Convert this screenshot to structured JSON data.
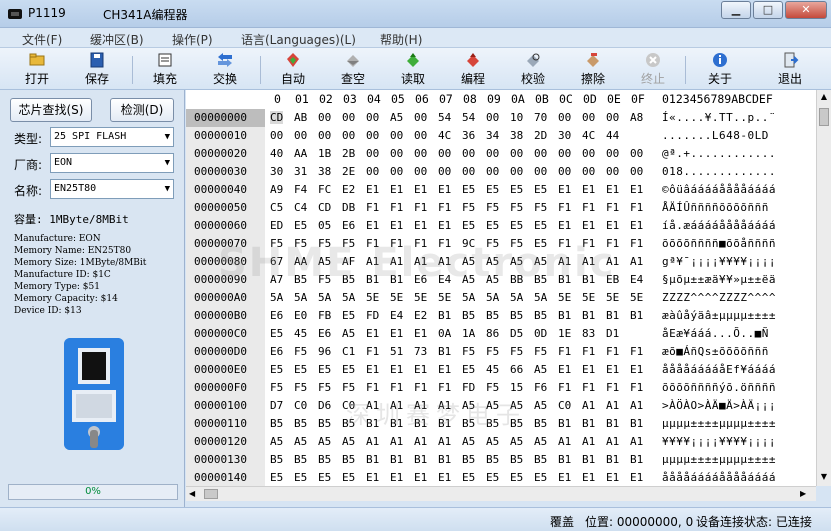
{
  "window": {
    "code": "P1119",
    "title": "CH341A编程器"
  },
  "menu": [
    {
      "label": "文件(F)"
    },
    {
      "label": "缓冲区(B)"
    },
    {
      "label": "操作(P)"
    },
    {
      "label": "语言(Languages)(L)"
    },
    {
      "label": "帮助(H)"
    }
  ],
  "toolbar": [
    {
      "label": "打开",
      "icon": "open-folder-icon",
      "enabled": true
    },
    {
      "label": "保存",
      "icon": "save-disk-icon",
      "enabled": true
    },
    {
      "label": "填充",
      "icon": "fill-icon",
      "enabled": true
    },
    {
      "label": "交换",
      "icon": "swap-icon",
      "enabled": true
    },
    {
      "label": "自动",
      "icon": "auto-icon",
      "enabled": true
    },
    {
      "label": "查空",
      "icon": "blank-check-icon",
      "enabled": true
    },
    {
      "label": "读取",
      "icon": "read-icon",
      "enabled": true
    },
    {
      "label": "编程",
      "icon": "program-icon",
      "enabled": true
    },
    {
      "label": "校验",
      "icon": "verify-icon",
      "enabled": true
    },
    {
      "label": "擦除",
      "icon": "erase-icon",
      "enabled": true
    },
    {
      "label": "终止",
      "icon": "stop-icon",
      "enabled": false
    },
    {
      "label": "关于",
      "icon": "info-icon",
      "enabled": true
    },
    {
      "label": "退出",
      "icon": "exit-icon",
      "enabled": true
    }
  ],
  "left": {
    "find_chip": "芯片查找(S)",
    "detect": "检测(D)",
    "type_label": "类型:",
    "type_value": "25 SPI FLASH",
    "vendor_label": "厂商:",
    "vendor_value": "EON",
    "name_label": "名称:",
    "name_value": "EN25T80",
    "capacity": "容量: 1MByte/8MBit",
    "info": [
      "Manufacture: EON",
      "Memory Name: EN25T80",
      "Memory Size: 1MByte/8MBit",
      "Manufacture ID: $1C",
      "Memory Type: $51",
      "Memory Capacity: $14",
      "Device ID: $13"
    ],
    "progress_value": 0,
    "progress_text": "0%"
  },
  "hex": {
    "columns": [
      "0",
      "01",
      "02",
      "03",
      "04",
      "05",
      "06",
      "07",
      "08",
      "09",
      "0A",
      "0B",
      "0C",
      "0D",
      "0E",
      "0F"
    ],
    "ascii_header": "0123456789ABCDEF",
    "watermark": "SHME Electronic",
    "watermark2": "深圳赛梦电子",
    "rows": [
      {
        "addr": "00000000",
        "bytes": [
          "CD",
          "AB",
          "00",
          "00",
          "00",
          "A5",
          "00",
          "54",
          "54",
          "00",
          "10",
          "70",
          "00",
          "00",
          "00",
          "A8"
        ],
        "ascii": "Í«....¥.TT..p..¨"
      },
      {
        "addr": "00000010",
        "bytes": [
          "00",
          "00",
          "00",
          "00",
          "00",
          "00",
          "00",
          "4C",
          "36",
          "34",
          "38",
          "2D",
          "30",
          "4C",
          "44"
        ],
        "ascii": ".......L648-0LD"
      },
      {
        "addr": "00000020",
        "bytes": [
          "40",
          "AA",
          "1B",
          "2B",
          "00",
          "00",
          "00",
          "00",
          "00",
          "00",
          "00",
          "00",
          "00",
          "00",
          "00",
          "00"
        ],
        "ascii": "@ª.+............"
      },
      {
        "addr": "00000030",
        "bytes": [
          "30",
          "31",
          "38",
          "2E",
          "00",
          "00",
          "00",
          "00",
          "00",
          "00",
          "00",
          "00",
          "00",
          "00",
          "00",
          "00"
        ],
        "ascii": "018............."
      },
      {
        "addr": "00000040",
        "bytes": [
          "A9",
          "F4",
          "FC",
          "E2",
          "E1",
          "E1",
          "E1",
          "E1",
          "E5",
          "E5",
          "E5",
          "E5",
          "E1",
          "E1",
          "E1",
          "E1"
        ],
        "ascii": "©ôüâááááååååáááá"
      },
      {
        "addr": "00000050",
        "bytes": [
          "C5",
          "C4",
          "CD",
          "DB",
          "F1",
          "F1",
          "F1",
          "F1",
          "F5",
          "F5",
          "F5",
          "F5",
          "F1",
          "F1",
          "F1",
          "F1"
        ],
        "ascii": "ÅÄÍÛññññõõõõñññ"
      },
      {
        "addr": "00000060",
        "bytes": [
          "ED",
          "E5",
          "05",
          "E6",
          "E1",
          "E1",
          "E1",
          "E1",
          "E5",
          "E5",
          "E5",
          "E5",
          "E1",
          "E1",
          "E1",
          "E1"
        ],
        "ascii": "íå.æááááååååáááá"
      },
      {
        "addr": "00000070",
        "bytes": [
          "F5",
          "F5",
          "F5",
          "F5",
          "F1",
          "F1",
          "F1",
          "F1",
          "9C",
          "F5",
          "F5",
          "E5",
          "F1",
          "F1",
          "F1",
          "F1"
        ],
        "ascii": "õõõõññññ■õõåññññ"
      },
      {
        "addr": "00000080",
        "bytes": [
          "67",
          "AA",
          "A5",
          "AF",
          "A1",
          "A1",
          "A1",
          "A1",
          "A5",
          "A5",
          "A5",
          "A5",
          "A1",
          "A1",
          "A1",
          "A1"
        ],
        "ascii": "gª¥¯¡¡¡¡¥¥¥¥¡¡¡¡"
      },
      {
        "addr": "00000090",
        "bytes": [
          "A7",
          "B5",
          "F5",
          "B5",
          "B1",
          "B1",
          "E6",
          "E4",
          "A5",
          "A5",
          "BB",
          "B5",
          "B1",
          "B1",
          "EB",
          "E4"
        ],
        "ascii": "§µõµ±±æä¥¥»µ±±ëä"
      },
      {
        "addr": "000000A0",
        "bytes": [
          "5A",
          "5A",
          "5A",
          "5A",
          "5E",
          "5E",
          "5E",
          "5E",
          "5A",
          "5A",
          "5A",
          "5A",
          "5E",
          "5E",
          "5E",
          "5E"
        ],
        "ascii": "ZZZZ^^^^ZZZZ^^^^"
      },
      {
        "addr": "000000B0",
        "bytes": [
          "E6",
          "E0",
          "FB",
          "E5",
          "FD",
          "E4",
          "E2",
          "B1",
          "B5",
          "B5",
          "B5",
          "B5",
          "B1",
          "B1",
          "B1",
          "B1"
        ],
        "ascii": "æàûåýäâ±µµµµ±±±±"
      },
      {
        "addr": "000000C0",
        "bytes": [
          "E5",
          "45",
          "E6",
          "A5",
          "E1",
          "E1",
          "E1",
          "0A",
          "1A",
          "86",
          "D5",
          "0D",
          "1E",
          "83",
          "D1"
        ],
        "ascii": "åEæ¥ááá...Õ..■Ñ"
      },
      {
        "addr": "000000D0",
        "bytes": [
          "E6",
          "F5",
          "96",
          "C1",
          "F1",
          "51",
          "73",
          "B1",
          "F5",
          "F5",
          "F5",
          "F5",
          "F1",
          "F1",
          "F1",
          "F1"
        ],
        "ascii": "æõ■ÁñQs±õõõõñññ"
      },
      {
        "addr": "000000E0",
        "bytes": [
          "E5",
          "E5",
          "E5",
          "E5",
          "E1",
          "E1",
          "E1",
          "E1",
          "E5",
          "45",
          "66",
          "A5",
          "E1",
          "E1",
          "E1",
          "E1"
        ],
        "ascii": "ååååááááåEf¥áááá"
      },
      {
        "addr": "000000F0",
        "bytes": [
          "F5",
          "F5",
          "F5",
          "F5",
          "F1",
          "F1",
          "F1",
          "F1",
          "FD",
          "F5",
          "15",
          "F6",
          "F1",
          "F1",
          "F1",
          "F1"
        ],
        "ascii": "õõõõññññýõ.öññññ"
      },
      {
        "addr": "00000100",
        "bytes": [
          "D7",
          "C0",
          "D6",
          "C0",
          "A1",
          "A1",
          "A1",
          "A1",
          "A5",
          "A5",
          "A5",
          "A5",
          "C0",
          "A1",
          "A1",
          "A1"
        ],
        "ascii": ">ÀÖÀO>ÀÄ■Ä>ÀÄ¡¡¡"
      },
      {
        "addr": "00000110",
        "bytes": [
          "B5",
          "B5",
          "B5",
          "B5",
          "B1",
          "B1",
          "B1",
          "B1",
          "B5",
          "B5",
          "B5",
          "B5",
          "B1",
          "B1",
          "B1",
          "B1"
        ],
        "ascii": "µµµµ±±±±µµµµ±±±±"
      },
      {
        "addr": "00000120",
        "bytes": [
          "A5",
          "A5",
          "A5",
          "A5",
          "A1",
          "A1",
          "A1",
          "A1",
          "A5",
          "A5",
          "A5",
          "A5",
          "A1",
          "A1",
          "A1",
          "A1"
        ],
        "ascii": "¥¥¥¥¡¡¡¡¥¥¥¥¡¡¡¡"
      },
      {
        "addr": "00000130",
        "bytes": [
          "B5",
          "B5",
          "B5",
          "B5",
          "B1",
          "B1",
          "B1",
          "B1",
          "B5",
          "B5",
          "B5",
          "B5",
          "B1",
          "B1",
          "B1",
          "B1"
        ],
        "ascii": "µµµµ±±±±µµµµ±±±±"
      },
      {
        "addr": "00000140",
        "bytes": [
          "E5",
          "E5",
          "E5",
          "E5",
          "E1",
          "E1",
          "E1",
          "E1",
          "E5",
          "E5",
          "E5",
          "E5",
          "E1",
          "E1",
          "E1",
          "E1"
        ],
        "ascii": "ååååááááååååáááá"
      }
    ]
  },
  "status": {
    "mode": "覆盖",
    "position_label": "位置: 00000000, 0",
    "connection_label": "设备连接状态: 已连接"
  },
  "colors": {
    "accent": "#2a7fe0",
    "progress_text": "#008c3c"
  }
}
